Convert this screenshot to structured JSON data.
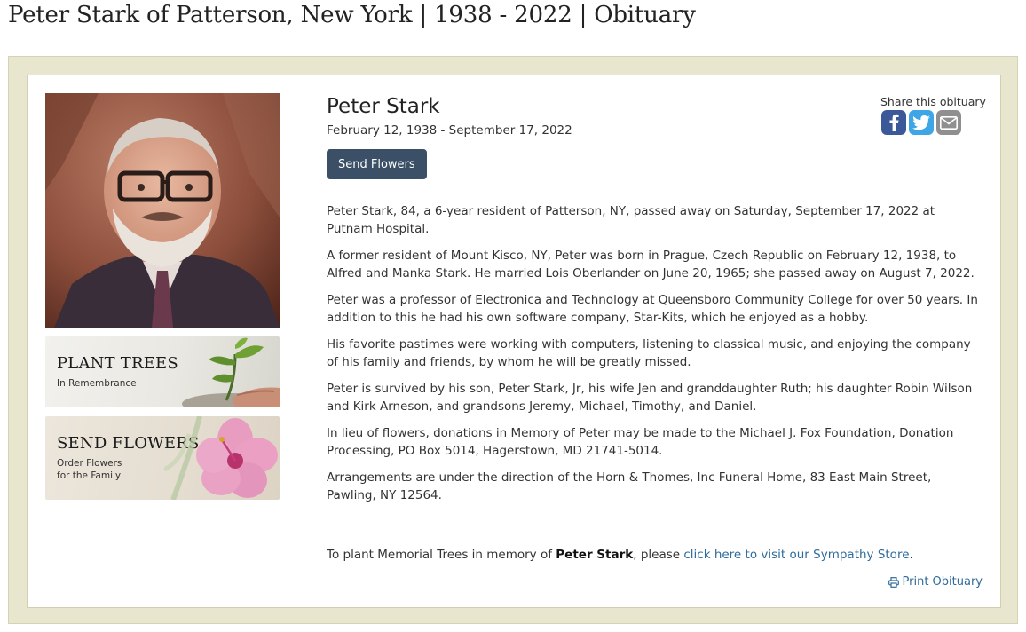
{
  "page": {
    "title": "Peter Stark of Patterson, New York | 1938 - 2022 | Obituary"
  },
  "sidebar": {
    "plant_trees": {
      "title": "PLANT TREES",
      "subtitle": "In Remembrance"
    },
    "send_flowers": {
      "title": "SEND FLOWERS",
      "subtitle_line1": "Order Flowers",
      "subtitle_line2": "for the Family"
    }
  },
  "obituary": {
    "name": "Peter Stark",
    "dates": "February 12, 1938 - September 17, 2022",
    "send_flowers_button": "Send Flowers",
    "share_label": "Share this obituary",
    "share_icons": [
      "facebook-icon",
      "twitter-icon",
      "email-icon"
    ],
    "paragraphs": [
      "Peter Stark, 84, a 6-year resident of Patterson, NY, passed away on Saturday, September 17, 2022 at Putnam Hospital.",
      "A former resident of Mount Kisco, NY, Peter was born in Prague, Czech Republic on February 12, 1938, to Alfred and Manka Stark.  He married Lois Oberlander on June 20, 1965; she passed away on August 7, 2022.",
      "Peter was a professor of Electronica and Technology at Queensboro Community College for over 50 years.  In addition to this he had his own software company, Star-Kits, which he enjoyed as a hobby.",
      "His favorite pastimes were working with computers, listening to classical music, and enjoying the company of his family and friends, by whom he will be greatly missed.",
      "Peter is survived by his son, Peter Stark, Jr, his wife Jen and granddaughter Ruth; his daughter Robin Wilson and Kirk Arneson, and grandsons Jeremy, Michael, Timothy, and Daniel.",
      "In lieu of flowers, donations in Memory of Peter may be made to the Michael J. Fox Foundation, Donation Processing, PO Box 5014, Hagerstown, MD 21741-5014.",
      "Arrangements are under the direction of the Horn & Thomes, Inc Funeral Home, 83 East Main Street, Pawling, NY 12564."
    ],
    "plant_line": {
      "prefix": "To plant Memorial Trees in memory of ",
      "name": "Peter Stark",
      "middle": ", please ",
      "link": "click here to visit our Sympathy Store",
      "suffix": "."
    },
    "print_label": "Print Obituary"
  },
  "colors": {
    "panel_background": "#e9e6cf",
    "button_background": "#3b4f66",
    "link": "#2e6b9c",
    "facebook": "#3b5998",
    "twitter": "#3ea6e6",
    "email": "#8f8f8f"
  }
}
